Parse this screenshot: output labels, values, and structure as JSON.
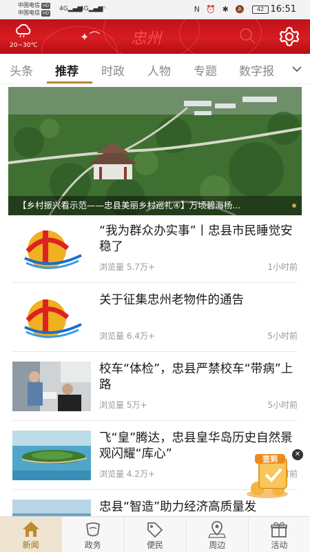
{
  "status_bar": {
    "carrier1": "中国电信",
    "carrier2": "中国电信",
    "hd": "HD",
    "signal": "4G",
    "battery": "42",
    "time": "16:51"
  },
  "header": {
    "temperature": "20~30℃",
    "logo_text": "忠州"
  },
  "tabs": [
    {
      "label": "头条"
    },
    {
      "label": "推荐"
    },
    {
      "label": "时政"
    },
    {
      "label": "人物"
    },
    {
      "label": "专题"
    },
    {
      "label": "数字报"
    }
  ],
  "active_tab": "推荐",
  "hero": {
    "caption": "【乡村振兴看示范——忠县美丽乡村巡礼④】万顷碧海杨..."
  },
  "news": [
    {
      "title": "“我为群众办实事”丨忠县市民睡觉安稳了",
      "views": "浏览量 5.7万+",
      "time": "1小时前",
      "thumb": "party-logo"
    },
    {
      "title": "关于征集忠州老物件的通告",
      "views": "浏览量 6.4万+",
      "time": "5小时前",
      "thumb": "party-logo"
    },
    {
      "title": "校车“体检”，忠县严禁校车“带病”上路",
      "views": "浏览量 5万+",
      "time": "5小时前",
      "thumb": "bus-inspection-photo"
    },
    {
      "title": "飞“皇”腾达，忠县皇华岛历史自然景观闪耀“库心”",
      "views": "浏览量 4.2万+",
      "time": "5小时前",
      "thumb": "island-photo"
    },
    {
      "title": "忠县“智造”助力经济高质量发",
      "thumb": "river-photo"
    }
  ],
  "signin": {
    "label": "签到"
  },
  "bottom_nav": [
    {
      "label": "新闻",
      "icon": "home-icon"
    },
    {
      "label": "政务",
      "icon": "government-icon"
    },
    {
      "label": "便民",
      "icon": "tag-icon"
    },
    {
      "label": "周边",
      "icon": "map-pin-icon"
    },
    {
      "label": "活动",
      "icon": "gift-icon"
    }
  ],
  "colors": {
    "header_red": "#d81c22",
    "accent_gold": "#b8893a"
  }
}
